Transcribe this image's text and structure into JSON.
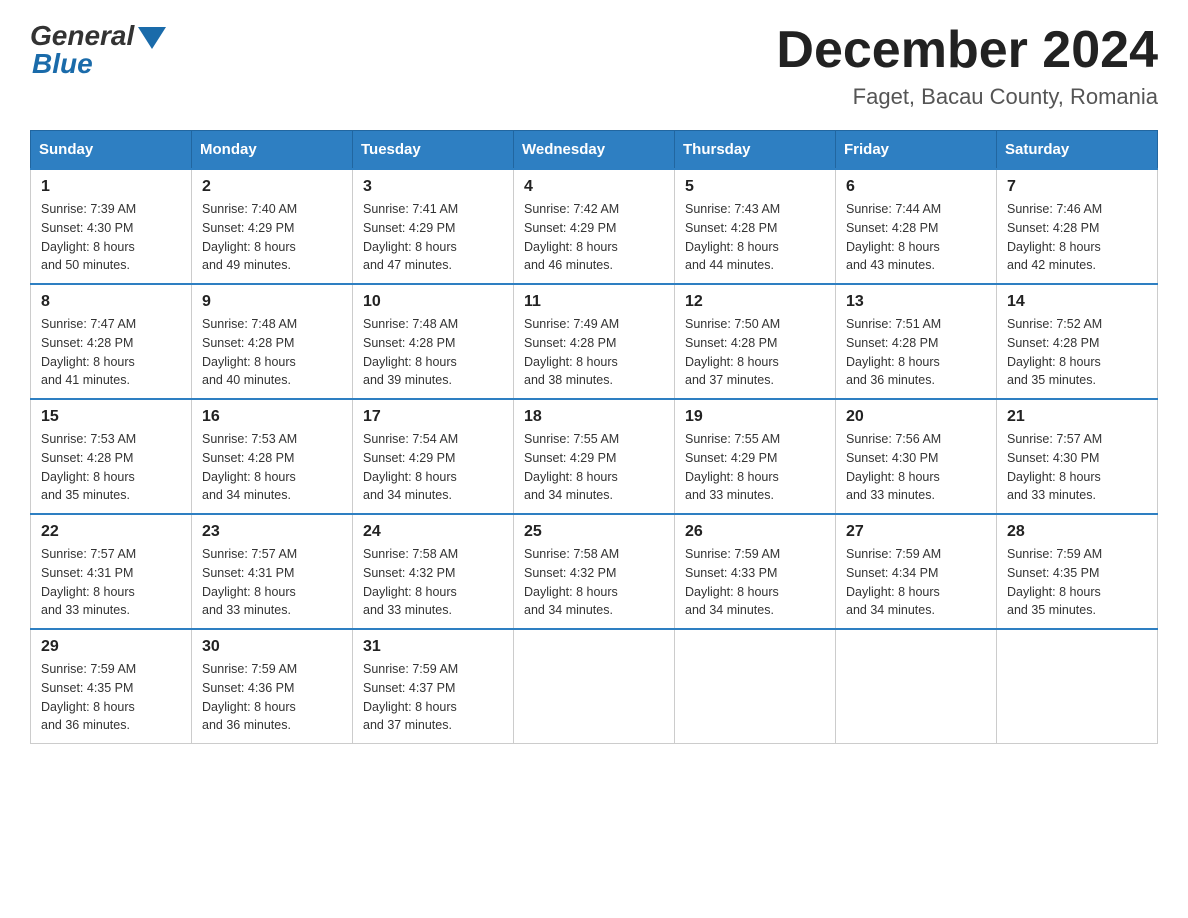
{
  "header": {
    "logo": {
      "general": "General",
      "blue": "Blue"
    },
    "title": "December 2024",
    "location": "Faget, Bacau County, Romania"
  },
  "days_of_week": [
    "Sunday",
    "Monday",
    "Tuesday",
    "Wednesday",
    "Thursday",
    "Friday",
    "Saturday"
  ],
  "weeks": [
    [
      {
        "day": "1",
        "sunrise": "7:39 AM",
        "sunset": "4:30 PM",
        "daylight": "8 hours and 50 minutes."
      },
      {
        "day": "2",
        "sunrise": "7:40 AM",
        "sunset": "4:29 PM",
        "daylight": "8 hours and 49 minutes."
      },
      {
        "day": "3",
        "sunrise": "7:41 AM",
        "sunset": "4:29 PM",
        "daylight": "8 hours and 47 minutes."
      },
      {
        "day": "4",
        "sunrise": "7:42 AM",
        "sunset": "4:29 PM",
        "daylight": "8 hours and 46 minutes."
      },
      {
        "day": "5",
        "sunrise": "7:43 AM",
        "sunset": "4:28 PM",
        "daylight": "8 hours and 44 minutes."
      },
      {
        "day": "6",
        "sunrise": "7:44 AM",
        "sunset": "4:28 PM",
        "daylight": "8 hours and 43 minutes."
      },
      {
        "day": "7",
        "sunrise": "7:46 AM",
        "sunset": "4:28 PM",
        "daylight": "8 hours and 42 minutes."
      }
    ],
    [
      {
        "day": "8",
        "sunrise": "7:47 AM",
        "sunset": "4:28 PM",
        "daylight": "8 hours and 41 minutes."
      },
      {
        "day": "9",
        "sunrise": "7:48 AM",
        "sunset": "4:28 PM",
        "daylight": "8 hours and 40 minutes."
      },
      {
        "day": "10",
        "sunrise": "7:48 AM",
        "sunset": "4:28 PM",
        "daylight": "8 hours and 39 minutes."
      },
      {
        "day": "11",
        "sunrise": "7:49 AM",
        "sunset": "4:28 PM",
        "daylight": "8 hours and 38 minutes."
      },
      {
        "day": "12",
        "sunrise": "7:50 AM",
        "sunset": "4:28 PM",
        "daylight": "8 hours and 37 minutes."
      },
      {
        "day": "13",
        "sunrise": "7:51 AM",
        "sunset": "4:28 PM",
        "daylight": "8 hours and 36 minutes."
      },
      {
        "day": "14",
        "sunrise": "7:52 AM",
        "sunset": "4:28 PM",
        "daylight": "8 hours and 35 minutes."
      }
    ],
    [
      {
        "day": "15",
        "sunrise": "7:53 AM",
        "sunset": "4:28 PM",
        "daylight": "8 hours and 35 minutes."
      },
      {
        "day": "16",
        "sunrise": "7:53 AM",
        "sunset": "4:28 PM",
        "daylight": "8 hours and 34 minutes."
      },
      {
        "day": "17",
        "sunrise": "7:54 AM",
        "sunset": "4:29 PM",
        "daylight": "8 hours and 34 minutes."
      },
      {
        "day": "18",
        "sunrise": "7:55 AM",
        "sunset": "4:29 PM",
        "daylight": "8 hours and 34 minutes."
      },
      {
        "day": "19",
        "sunrise": "7:55 AM",
        "sunset": "4:29 PM",
        "daylight": "8 hours and 33 minutes."
      },
      {
        "day": "20",
        "sunrise": "7:56 AM",
        "sunset": "4:30 PM",
        "daylight": "8 hours and 33 minutes."
      },
      {
        "day": "21",
        "sunrise": "7:57 AM",
        "sunset": "4:30 PM",
        "daylight": "8 hours and 33 minutes."
      }
    ],
    [
      {
        "day": "22",
        "sunrise": "7:57 AM",
        "sunset": "4:31 PM",
        "daylight": "8 hours and 33 minutes."
      },
      {
        "day": "23",
        "sunrise": "7:57 AM",
        "sunset": "4:31 PM",
        "daylight": "8 hours and 33 minutes."
      },
      {
        "day": "24",
        "sunrise": "7:58 AM",
        "sunset": "4:32 PM",
        "daylight": "8 hours and 33 minutes."
      },
      {
        "day": "25",
        "sunrise": "7:58 AM",
        "sunset": "4:32 PM",
        "daylight": "8 hours and 34 minutes."
      },
      {
        "day": "26",
        "sunrise": "7:59 AM",
        "sunset": "4:33 PM",
        "daylight": "8 hours and 34 minutes."
      },
      {
        "day": "27",
        "sunrise": "7:59 AM",
        "sunset": "4:34 PM",
        "daylight": "8 hours and 34 minutes."
      },
      {
        "day": "28",
        "sunrise": "7:59 AM",
        "sunset": "4:35 PM",
        "daylight": "8 hours and 35 minutes."
      }
    ],
    [
      {
        "day": "29",
        "sunrise": "7:59 AM",
        "sunset": "4:35 PM",
        "daylight": "8 hours and 36 minutes."
      },
      {
        "day": "30",
        "sunrise": "7:59 AM",
        "sunset": "4:36 PM",
        "daylight": "8 hours and 36 minutes."
      },
      {
        "day": "31",
        "sunrise": "7:59 AM",
        "sunset": "4:37 PM",
        "daylight": "8 hours and 37 minutes."
      },
      null,
      null,
      null,
      null
    ]
  ],
  "labels": {
    "sunrise": "Sunrise:",
    "sunset": "Sunset:",
    "daylight": "Daylight:"
  }
}
